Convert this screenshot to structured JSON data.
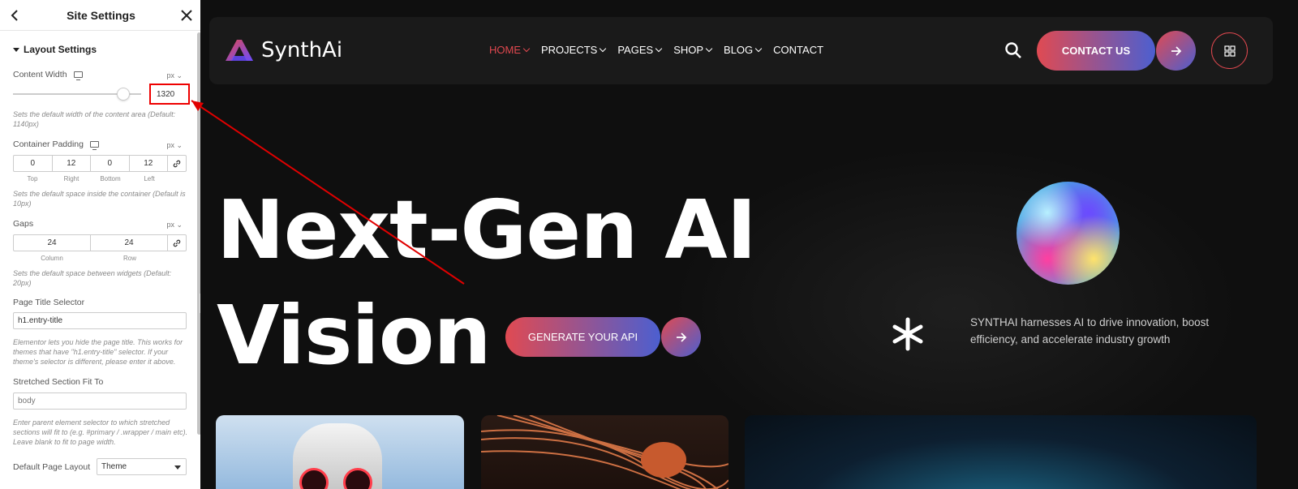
{
  "panel": {
    "title": "Site Settings",
    "section_title": "Layout Settings",
    "content_width": {
      "label": "Content Width",
      "unit": "px",
      "value": "1320",
      "help": "Sets the default width of the content area (Default: 1140px)"
    },
    "container_padding": {
      "label": "Container Padding",
      "unit": "px",
      "values": [
        "0",
        "12",
        "0",
        "12"
      ],
      "sublabels": [
        "Top",
        "Right",
        "Bottom",
        "Left"
      ],
      "help": "Sets the default space inside the container (Default is 10px)"
    },
    "gaps": {
      "label": "Gaps",
      "unit": "px",
      "values": [
        "24",
        "24"
      ],
      "sublabels": [
        "Column",
        "Row"
      ],
      "help": "Sets the default space between widgets (Default: 20px)"
    },
    "page_title_selector": {
      "label": "Page Title Selector",
      "value": "h1.entry-title",
      "help": "Elementor lets you hide the page title. This works for themes that have \"h1.entry-title\" selector. If your theme's selector is different, please enter it above."
    },
    "stretched_section": {
      "label": "Stretched Section Fit To",
      "placeholder": "body",
      "help": "Enter parent element selector to which stretched sections will fit to (e.g. #primary / .wrapper / main etc). Leave blank to fit to page width."
    },
    "default_page_layout": {
      "label": "Default Page Layout",
      "value": "Theme"
    }
  },
  "site": {
    "logo": "SynthAi",
    "menu": [
      {
        "label": "HOME",
        "dropdown": true,
        "active": true
      },
      {
        "label": "PROJECTS",
        "dropdown": true,
        "active": false
      },
      {
        "label": "PAGES",
        "dropdown": true,
        "active": false
      },
      {
        "label": "SHOP",
        "dropdown": true,
        "active": false
      },
      {
        "label": "BLOG",
        "dropdown": true,
        "active": false
      },
      {
        "label": "CONTACT",
        "dropdown": false,
        "active": false
      }
    ],
    "cta_label": "CONTACT US",
    "hero_line1": "Next-Gen AI",
    "hero_line2": "Vision",
    "generate_label": "GENERATE YOUR API",
    "tagline": "SYNTHAI harnesses AI to drive innovation, boost efficiency, and accelerate industry growth",
    "colors": {
      "accent": "#e0484f",
      "gradient_start": "#e04a52",
      "gradient_end": "#4c5fd0",
      "background": "#0f0f0f",
      "annotation": "#e00000"
    }
  }
}
